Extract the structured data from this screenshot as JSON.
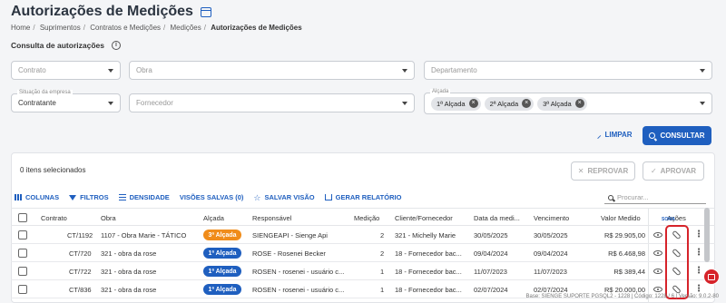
{
  "page": {
    "title": "Autorizações de Medições",
    "breadcrumb": [
      "Home",
      "Suprimentos",
      "Contratos e Medições",
      "Medições",
      "Autorizações de Medições"
    ]
  },
  "filters": {
    "section_title": "Consulta de autorizações",
    "contrato_placeholder": "Contrato",
    "obra_placeholder": "Obra",
    "departamento_placeholder": "Departamento",
    "situacao_label": "Situação da empresa",
    "situacao_value": "Contratante",
    "fornecedor_placeholder": "Fornecedor",
    "alcada_label": "Alçada",
    "alcada_chips": [
      "1ª Alçada",
      "2ª Alçada",
      "3ª Alçada"
    ],
    "limpar_label": "LIMPAR",
    "consultar_label": "CONSULTAR"
  },
  "actions": {
    "selected_text": "0 itens selecionados",
    "reprovar_label": "REPROVAR",
    "aprovar_label": "APROVAR"
  },
  "toolbar": {
    "colunas": "COLUNAS",
    "filtros": "FILTROS",
    "densidade": "DENSIDADE",
    "visoes_salvas": "VISÕES SALVAS (0)",
    "salvar_visao": "SALVAR VISÃO",
    "gerar_relatorio": "GERAR RELATÓRIO",
    "search_placeholder": "Procurar..."
  },
  "table": {
    "headers": {
      "contrato": "Contrato",
      "obra": "Obra",
      "alcada": "Alçada",
      "responsavel": "Responsável",
      "medicao": "Medição",
      "cliente": "Cliente/Fornecedor",
      "data": "Data da medi...",
      "vencimento": "Vencimento",
      "valor": "Valor Medido",
      "acoes": "Ações",
      "soma": "SOMA"
    },
    "rows": [
      {
        "contrato": "CT/1192",
        "obra": "1107 - Obra Marie - TÁTICO",
        "alcada": "3ª Alçada",
        "alcada_color": "#f08c1a",
        "responsavel": "SIENGEAPI - Sienge Api",
        "medicao": "2",
        "cliente": "321 - Michelly Marie",
        "data": "30/05/2025",
        "vencimento": "30/05/2025",
        "valor": "R$ 29.905,00"
      },
      {
        "contrato": "CT/720",
        "obra": "321 - obra da rose",
        "alcada": "1ª Alçada",
        "alcada_color": "#1f5fbf",
        "responsavel": "ROSE - Rosenei Becker",
        "medicao": "2",
        "cliente": "18 - Fornecedor bac...",
        "data": "09/04/2024",
        "vencimento": "09/04/2024",
        "valor": "R$ 6.468,98"
      },
      {
        "contrato": "CT/722",
        "obra": "321 - obra da rose",
        "alcada": "1ª Alçada",
        "alcada_color": "#1f5fbf",
        "responsavel": "ROSEN - rosenei - usuário c...",
        "medicao": "1",
        "cliente": "18 - Fornecedor bac...",
        "data": "11/07/2023",
        "vencimento": "11/07/2023",
        "valor": "R$ 389,44"
      },
      {
        "contrato": "CT/836",
        "obra": "321 - obra da rose",
        "alcada": "1ª Alçada",
        "alcada_color": "#1f5fbf",
        "responsavel": "ROSEN - rosenei - usuário c...",
        "medicao": "1",
        "cliente": "18 - Fornecedor bac...",
        "data": "02/07/2024",
        "vencimento": "02/07/2024",
        "valor": "R$ 20.000,00"
      }
    ]
  },
  "footer": {
    "text": "Base: SIENGE SUPORTE PGSQL2 - 1228 | Código: 1228 / 6 | Versão: 9.0.2-80"
  },
  "colors": {
    "primary": "#1f5fbf",
    "alcada_3": "#f08c1a",
    "highlight": "#d6232a"
  }
}
